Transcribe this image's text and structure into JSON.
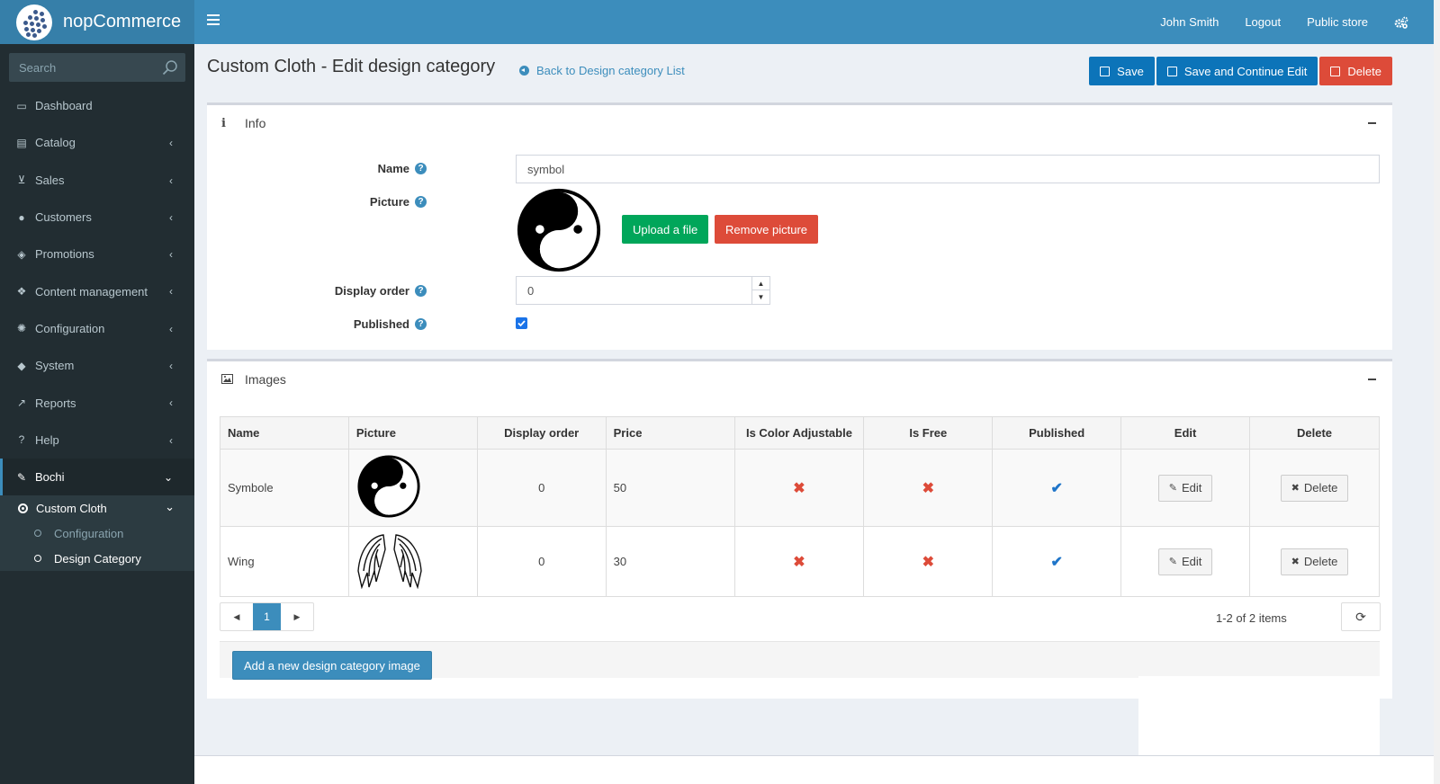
{
  "app": {
    "logo_text": "nopCommerce"
  },
  "topnav": {
    "user": "John Smith",
    "logout": "Logout",
    "public_store": "Public store"
  },
  "sidebar": {
    "search_placeholder": "Search",
    "items": [
      {
        "label": "Dashboard",
        "icon": "monitor-icon",
        "chevron": false
      },
      {
        "label": "Catalog",
        "icon": "book-icon",
        "chevron": true
      },
      {
        "label": "Sales",
        "icon": "cart-icon",
        "chevron": true
      },
      {
        "label": "Customers",
        "icon": "user-icon",
        "chevron": true
      },
      {
        "label": "Promotions",
        "icon": "tags-icon",
        "chevron": true
      },
      {
        "label": "Content management",
        "icon": "cubes-icon",
        "chevron": true
      },
      {
        "label": "Configuration",
        "icon": "gears-icon",
        "chevron": true
      },
      {
        "label": "System",
        "icon": "cube-icon",
        "chevron": true
      },
      {
        "label": "Reports",
        "icon": "line-chart-icon",
        "chevron": true
      },
      {
        "label": "Help",
        "icon": "question-icon",
        "chevron": true
      },
      {
        "label": "Bochi",
        "icon": "feather-icon",
        "chevron": true
      }
    ],
    "submenu": {
      "label": "Custom Cloth",
      "children": [
        "Configuration",
        "Design Category"
      ]
    }
  },
  "header": {
    "title": "Custom Cloth - Edit design category",
    "back_link": "Back to Design category List",
    "save": "Save",
    "save_continue": "Save and Continue Edit",
    "delete": "Delete"
  },
  "info_panel": {
    "title": "Info",
    "name_label": "Name",
    "name_value": "symbol",
    "picture_label": "Picture",
    "upload_label": "Upload a file",
    "remove_label": "Remove picture",
    "display_order_label": "Display order",
    "display_order_value": "0",
    "published_label": "Published",
    "published": true
  },
  "images_panel": {
    "title": "Images",
    "columns": [
      "Name",
      "Picture",
      "Display order",
      "Price",
      "Is Color Adjustable",
      "Is Free",
      "Published",
      "Edit",
      "Delete"
    ],
    "rows": [
      {
        "name": "Symbole",
        "picture": "yin-yang-icon",
        "display_order": "0",
        "price": "50",
        "is_color_adjustable": false,
        "is_free": false,
        "published": true,
        "edit": "Edit",
        "delete": "Delete"
      },
      {
        "name": "Wing",
        "picture": "wings-icon",
        "display_order": "0",
        "price": "30",
        "is_color_adjustable": false,
        "is_free": false,
        "published": true,
        "edit": "Edit",
        "delete": "Delete"
      }
    ],
    "pager": {
      "current_page": "1"
    },
    "items_info": "1-2 of 2 items",
    "add_button": "Add a new design category image"
  },
  "colors": {
    "header": "#3c8dbc",
    "sidebar": "#222d32",
    "primary": "#0c74b9",
    "danger": "#dd4b39",
    "success": "#00a65a"
  }
}
